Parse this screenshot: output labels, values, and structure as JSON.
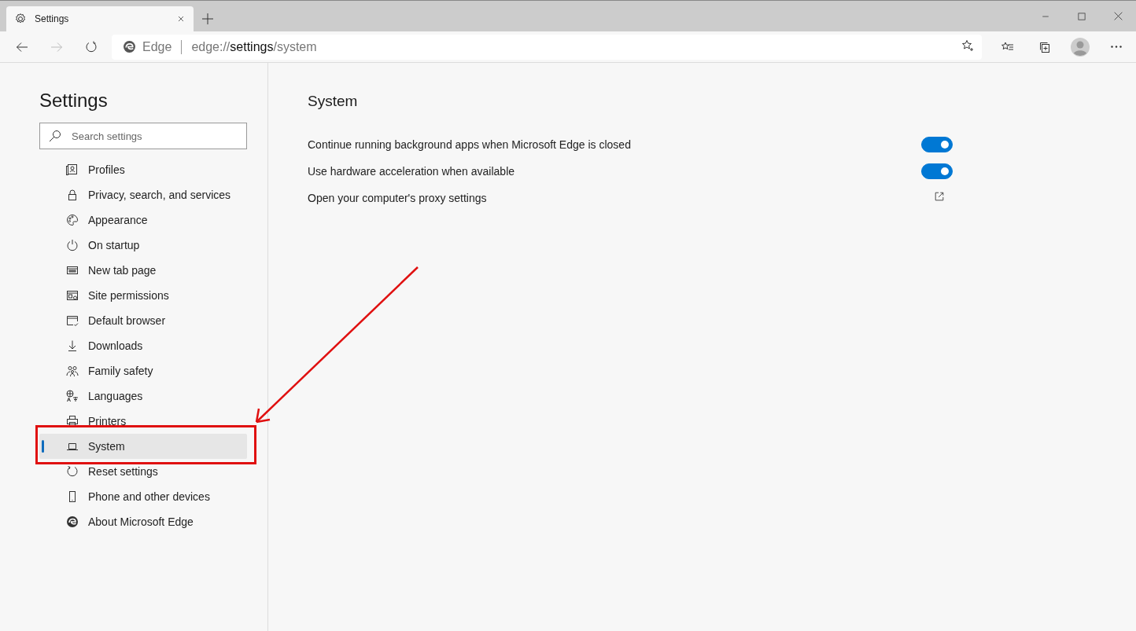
{
  "tab": {
    "title": "Settings",
    "selected": true
  },
  "address_bar": {
    "site_label": "Edge",
    "url": "edge://**settings**/system"
  },
  "sidebar": {
    "title": "Settings",
    "search": {
      "placeholder": "Search settings"
    },
    "items": [
      {
        "label": "Profiles",
        "selected": false
      },
      {
        "label": "Privacy, search, and services",
        "selected": false
      },
      {
        "label": "Appearance",
        "selected": false
      },
      {
        "label": "On startup",
        "selected": false
      },
      {
        "label": "New tab page",
        "selected": false
      },
      {
        "label": "Site permissions",
        "selected": false
      },
      {
        "label": "Default browser",
        "selected": false
      },
      {
        "label": "Downloads",
        "selected": false
      },
      {
        "label": "Family safety",
        "selected": false
      },
      {
        "label": "Languages",
        "selected": false
      },
      {
        "label": "Printers",
        "selected": false
      },
      {
        "label": "System",
        "selected": true
      },
      {
        "label": "Reset settings",
        "selected": false
      },
      {
        "label": "Phone and other devices",
        "selected": false
      },
      {
        "label": "About Microsoft Edge",
        "selected": false
      }
    ]
  },
  "main": {
    "title": "System",
    "settings": [
      {
        "kind": "toggle",
        "label": "Continue running background apps when Microsoft Edge is closed",
        "on": true
      },
      {
        "kind": "toggle",
        "label": "Use hardware acceleration when available",
        "on": true
      },
      {
        "kind": "link",
        "label": "Open your computer's proxy settings"
      }
    ]
  }
}
